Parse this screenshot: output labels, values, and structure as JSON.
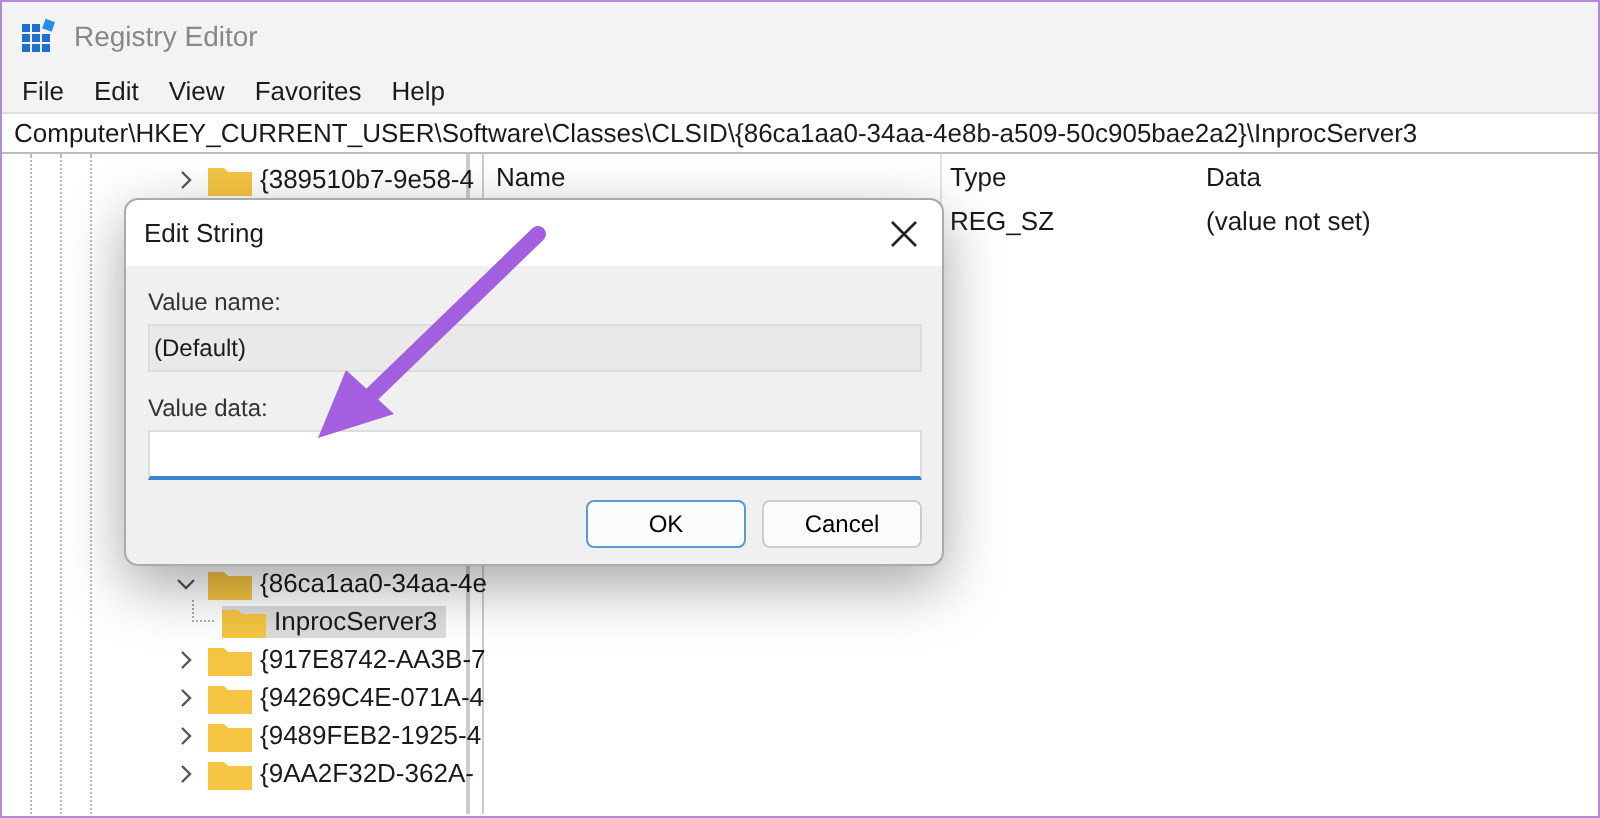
{
  "window": {
    "title": "Registry Editor"
  },
  "menu": [
    {
      "label": "File"
    },
    {
      "label": "Edit"
    },
    {
      "label": "View"
    },
    {
      "label": "Favorites"
    },
    {
      "label": "Help"
    }
  ],
  "address_bar": {
    "value": "Computer\\HKEY_CURRENT_USER\\Software\\Classes\\CLSID\\{86ca1aa0-34aa-4e8b-a509-50c905bae2a2}\\InprocServer3"
  },
  "tree_top": [
    {
      "label": "{389510b7-9e58-4",
      "expanded": false,
      "selected": false
    }
  ],
  "tree": [
    {
      "label": "{86ca1aa0-34aa-4e",
      "expanded": true,
      "selected": false,
      "children": [
        {
          "label": "InprocServer3",
          "selected": true
        }
      ]
    },
    {
      "label": "{917E8742-AA3B-7",
      "expanded": false,
      "selected": false
    },
    {
      "label": "{94269C4E-071A-4",
      "expanded": false,
      "selected": false
    },
    {
      "label": "{9489FEB2-1925-4",
      "expanded": false,
      "selected": false
    },
    {
      "label": "{9AA2F32D-362A-",
      "expanded": false,
      "selected": false
    }
  ],
  "table": {
    "columns": [
      "Name",
      "Type",
      "Data"
    ],
    "rows": [
      {
        "type": "REG_SZ",
        "data": "(value not set)"
      }
    ]
  },
  "dialog": {
    "title": "Edit String",
    "value_name_label": "Value name:",
    "value_name": "(Default)",
    "value_data_label": "Value data:",
    "buttons": [
      {
        "label": "OK",
        "default": true
      },
      {
        "label": "Cancel",
        "default": false
      }
    ]
  }
}
